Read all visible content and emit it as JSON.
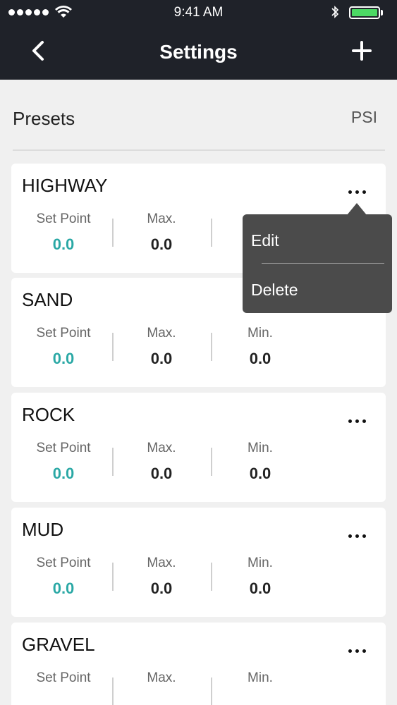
{
  "status_bar": {
    "time": "9:41 AM"
  },
  "header": {
    "title": "Settings"
  },
  "section": {
    "title": "Presets",
    "unit": "PSI"
  },
  "labels": {
    "set_point": "Set  Point",
    "max": "Max.",
    "min": "Min."
  },
  "presets": [
    {
      "name": "HIGHWAY",
      "set_point": "0.0",
      "max": "0.0",
      "min": ""
    },
    {
      "name": "SAND",
      "set_point": "0.0",
      "max": "0.0",
      "min": "0.0"
    },
    {
      "name": "ROCK",
      "set_point": "0.0",
      "max": "0.0",
      "min": "0.0"
    },
    {
      "name": "MUD",
      "set_point": "0.0",
      "max": "0.0",
      "min": "0.0"
    },
    {
      "name": "GRAVEL",
      "set_point": "",
      "max": "",
      "min": ""
    }
  ],
  "menu": {
    "edit": "Edit",
    "delete": "Delete"
  },
  "colors": {
    "header_bg": "#1f2229",
    "accent_teal": "#2aa8a5",
    "battery_green": "#4cd964",
    "menu_bg": "#4b4b4b"
  },
  "icons": {
    "back": "chevron-left-icon",
    "add": "plus-icon",
    "more": "more-horizontal-icon"
  }
}
